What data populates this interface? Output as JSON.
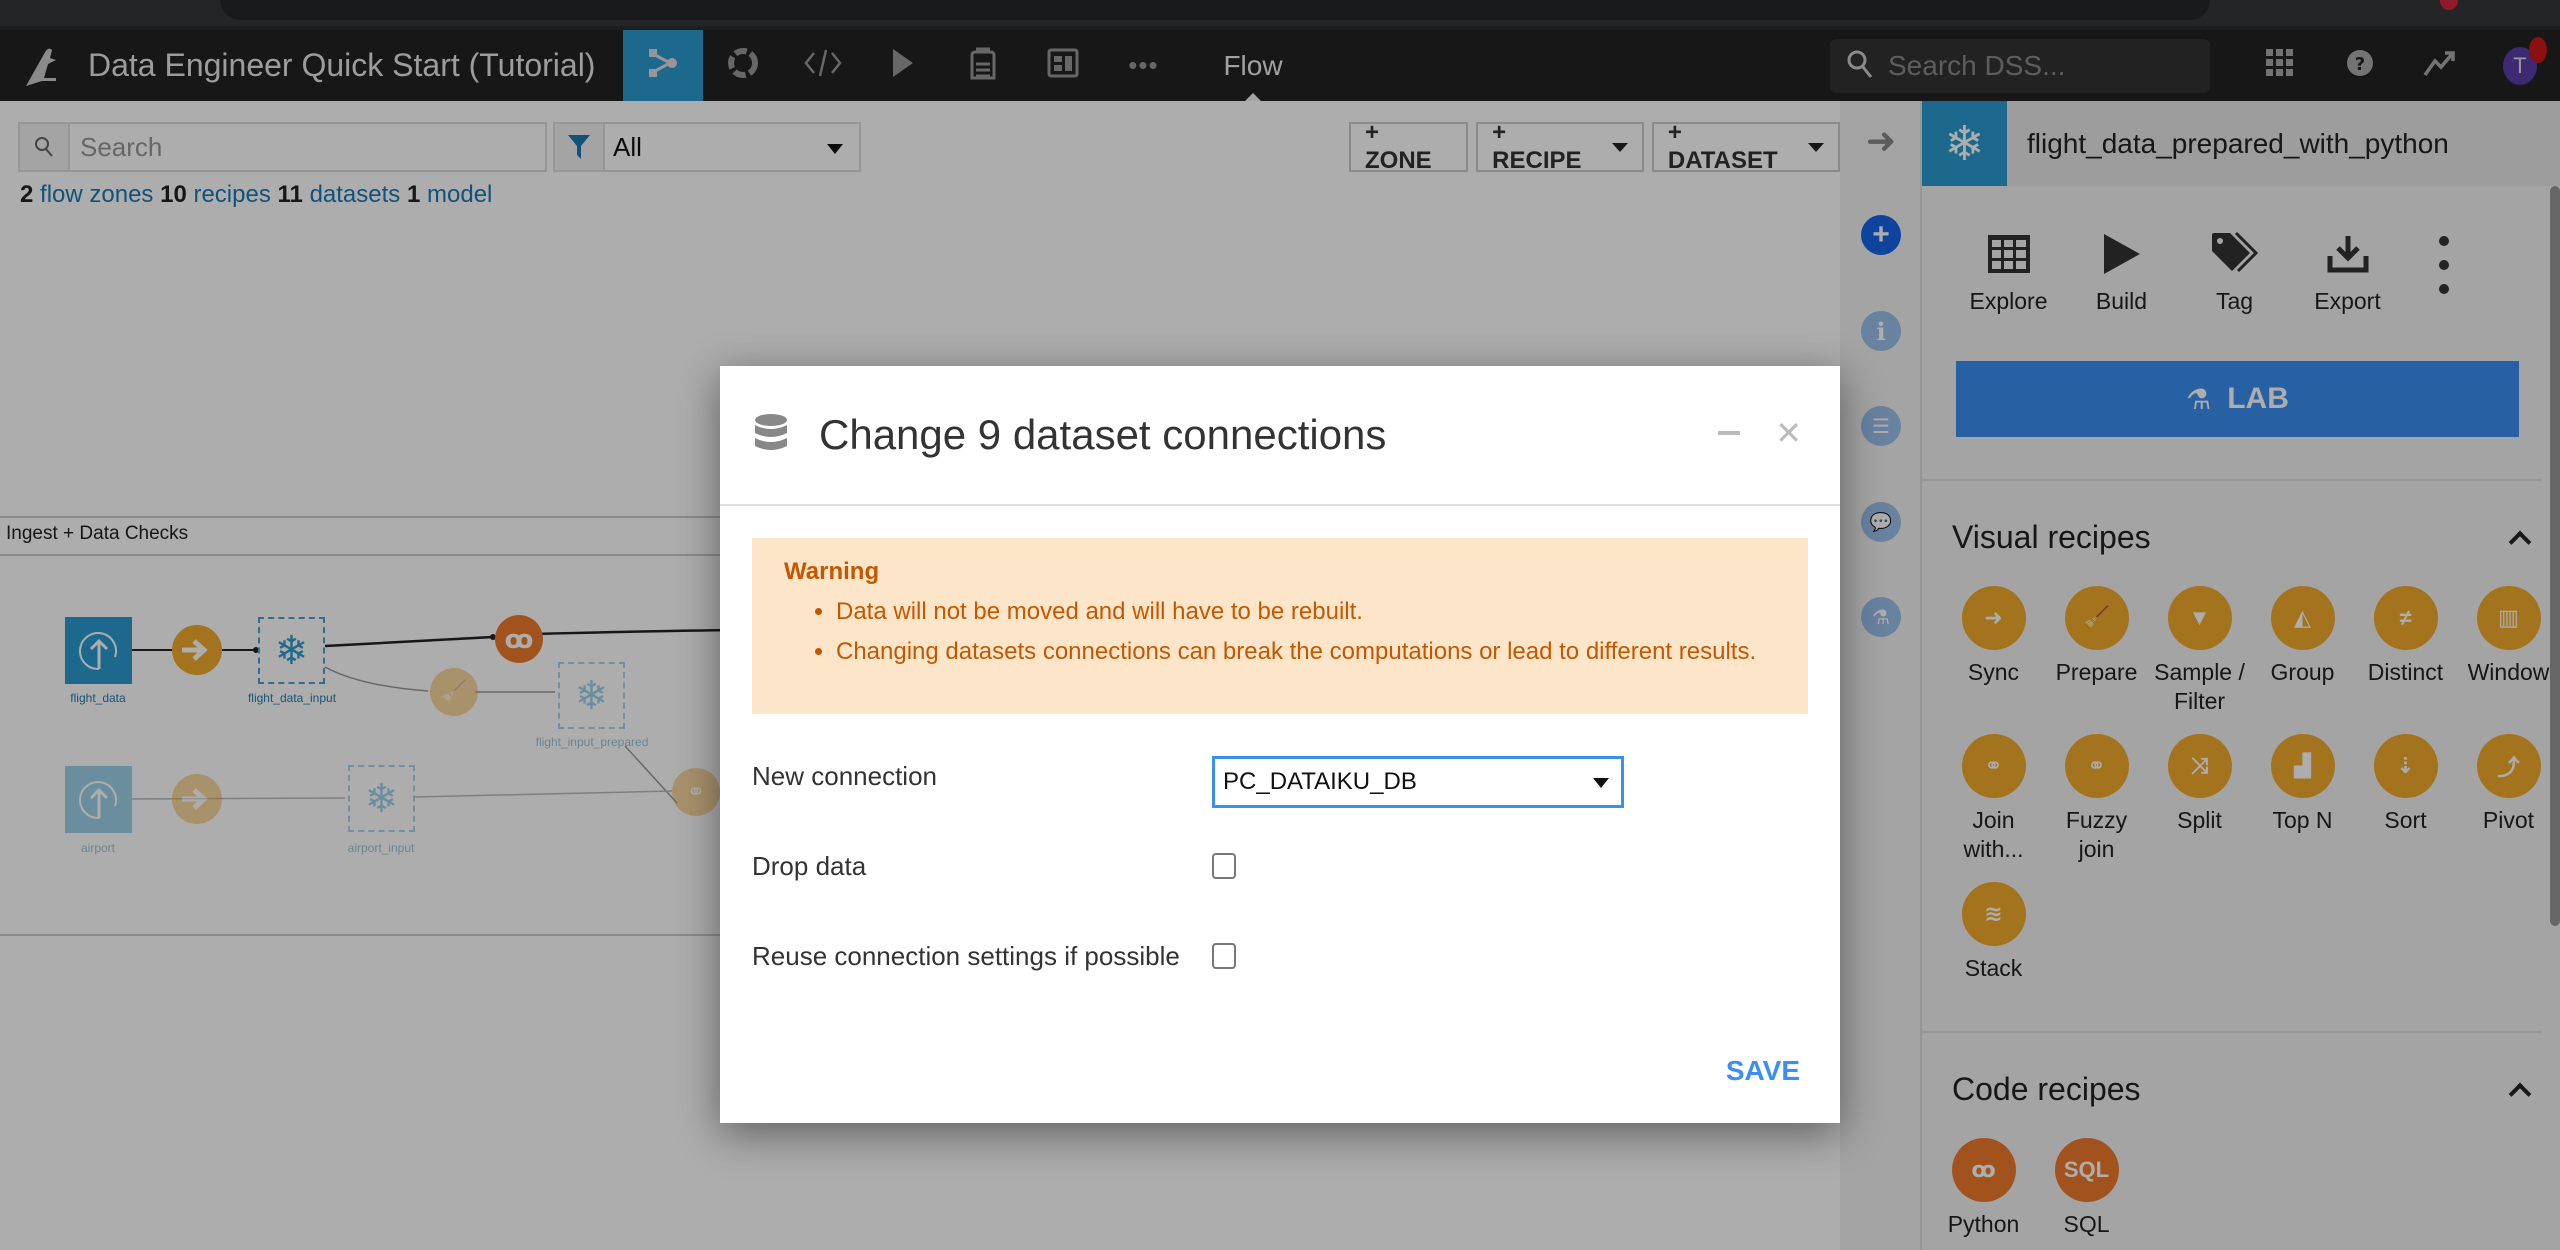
{
  "nav": {
    "project_title": "Data Engineer Quick Start (Tutorial)",
    "current_section": "Flow",
    "icons": [
      "flow-icon",
      "lab-icon",
      "code-icon",
      "jobs-icon",
      "datasets-stack-icon",
      "dashboard-icon",
      "more-icon"
    ],
    "search_placeholder": "Search DSS...",
    "avatar_initial": "T"
  },
  "flow": {
    "search_placeholder": "Search",
    "filter_value": "All",
    "stats": {
      "zones_count": "2",
      "zones_label": "flow zones",
      "recipes_count": "10",
      "recipes_label": "recipes",
      "datasets_count": "11",
      "datasets_label": "datasets",
      "models_count": "1",
      "models_label": "model"
    },
    "buttons": {
      "zone": "+ ZONE",
      "recipe": "+ RECIPE",
      "dataset": "+ DATASET"
    },
    "zone_name": "Ingest + Data Checks",
    "nodes": [
      {
        "label": "flight_data",
        "type": "uploaded-dataset"
      },
      {
        "label": "",
        "type": "sync-recipe"
      },
      {
        "label": "flight_data_input",
        "type": "snowflake-dataset"
      },
      {
        "label": "",
        "type": "python-recipe"
      },
      {
        "label": "",
        "type": "prepare-recipe"
      },
      {
        "label": "flight_input_prepared",
        "type": "snowflake-dataset"
      },
      {
        "label": "airport",
        "type": "uploaded-dataset"
      },
      {
        "label": "",
        "type": "sync-recipe"
      },
      {
        "label": "airport_input",
        "type": "snowflake-dataset"
      },
      {
        "label": "",
        "type": "join-recipe"
      }
    ]
  },
  "rail": {
    "icons": [
      "collapse-arrow-icon",
      "add-icon",
      "info-icon",
      "schema-icon",
      "discussion-icon",
      "lab-icon"
    ]
  },
  "panel": {
    "dataset_name": "flight_data_prepared_with_python",
    "actions": [
      {
        "label": "Explore",
        "icon": "table-icon"
      },
      {
        "label": "Build",
        "icon": "play-icon"
      },
      {
        "label": "Tag",
        "icon": "tag-icon"
      },
      {
        "label": "Export",
        "icon": "download-icon"
      }
    ],
    "lab_label": "LAB",
    "visual_recipes_title": "Visual recipes",
    "visual_recipes": [
      {
        "label": "Sync",
        "icon": "arrow-right"
      },
      {
        "label": "Prepare",
        "icon": "broom"
      },
      {
        "label": "Sample / Filter",
        "icon": "funnel"
      },
      {
        "label": "Group",
        "icon": "shapes"
      },
      {
        "label": "Distinct",
        "icon": "not-equal"
      },
      {
        "label": "Window",
        "icon": "window"
      },
      {
        "label": "Join with...",
        "icon": "venn"
      },
      {
        "label": "Fuzzy join",
        "icon": "fuzzy-venn"
      },
      {
        "label": "Split",
        "icon": "split"
      },
      {
        "label": "Top N",
        "icon": "podium"
      },
      {
        "label": "Sort",
        "icon": "sort"
      },
      {
        "label": "Pivot",
        "icon": "pivot"
      },
      {
        "label": "Stack",
        "icon": "layers"
      }
    ],
    "code_recipes_title": "Code recipes",
    "code_recipes": [
      {
        "label": "Python",
        "icon": "python"
      },
      {
        "label": "SQL",
        "icon": "sql",
        "glyph": "SQL"
      }
    ]
  },
  "modal": {
    "title": "Change 9 dataset connections",
    "warning_title": "Warning",
    "warnings": [
      "Data will not be moved and will have to be rebuilt.",
      "Changing datasets connections can break the computations or lead to different results."
    ],
    "new_connection_label": "New connection",
    "new_connection_value": "PC_DATAIKU_DB",
    "drop_data_label": "Drop data",
    "drop_data_checked": false,
    "reuse_label": "Reuse connection settings if possible",
    "reuse_checked": false,
    "save_label": "SAVE"
  },
  "colors": {
    "accent_blue": "#2b9bd1",
    "primary_button": "#3a8ff0",
    "visual_recipe": "#f0ab2c",
    "code_recipe": "#ef7b2b",
    "warning_bg": "#fde5ca",
    "warning_text": "#c45800"
  }
}
